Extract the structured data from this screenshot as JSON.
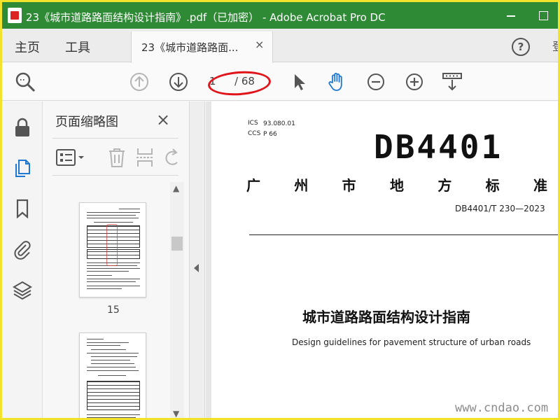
{
  "window": {
    "title": "23《城市道路路面结构设计指南》.pdf（已加密） - Adobe Acrobat Pro DC"
  },
  "menu": {
    "home": "主页",
    "tools": "工具"
  },
  "tab": {
    "label": "23《城市道路路面...",
    "close": "×"
  },
  "toolbar": {
    "current_page": "1",
    "total_pages": "/ 68"
  },
  "icons": {
    "toolbar": [
      "search-zoom-icon",
      "page-up-icon",
      "page-down-icon",
      "select-cursor-icon",
      "hand-tool-icon",
      "zoom-out-icon",
      "zoom-in-icon",
      "scroll-mode-icon"
    ],
    "rail": [
      "lock-icon",
      "pages-icon",
      "bookmark-icon",
      "attachment-icon",
      "layers-icon"
    ]
  },
  "colors": {
    "titlebar": "#2f8a35",
    "accent": "#1f78d1",
    "annotation": "#e0141a"
  },
  "thumbnails": {
    "panel_title": "页面缩略图",
    "close": "×",
    "pages": [
      {
        "label": "15"
      },
      {
        "label": ""
      }
    ]
  },
  "document": {
    "ics_label": "ICS",
    "ics_value": "93.080.01",
    "ccs_label": "CCS",
    "ccs_value": "P 66",
    "std_code": "DB4401",
    "std_type_chars": [
      "广",
      "州",
      "市",
      "地",
      "方",
      "标",
      "准"
    ],
    "std_number": "DB4401/T 230—2023",
    "title_zh": "城市道路路面结构设计指南",
    "title_en": "Design guidelines for pavement structure of urban roads"
  },
  "watermark": "www.cndao.com"
}
